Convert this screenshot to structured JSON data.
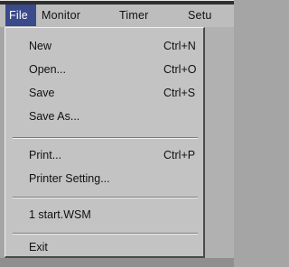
{
  "menubar": {
    "items": [
      {
        "label": "File",
        "active": true
      },
      {
        "label": "Monitor",
        "active": false
      },
      {
        "label": "Timer",
        "active": false
      },
      {
        "label": "Setu",
        "active": false
      }
    ]
  },
  "file_menu": {
    "items": [
      {
        "label": "New",
        "shortcut": "Ctrl+N"
      },
      {
        "label": "Open...",
        "shortcut": "Ctrl+O"
      },
      {
        "label": "Save",
        "shortcut": "Ctrl+S"
      },
      {
        "label": "Save As...",
        "shortcut": ""
      },
      {
        "label": "Print...",
        "shortcut": "Ctrl+P"
      },
      {
        "label": "Printer Setting...",
        "shortcut": ""
      },
      {
        "label": "1 start.WSM",
        "shortcut": ""
      },
      {
        "label": "Exit",
        "shortcut": ""
      }
    ]
  },
  "colors": {
    "menu_background": "#c3c3c3",
    "active_highlight": "#3b4a8a"
  }
}
